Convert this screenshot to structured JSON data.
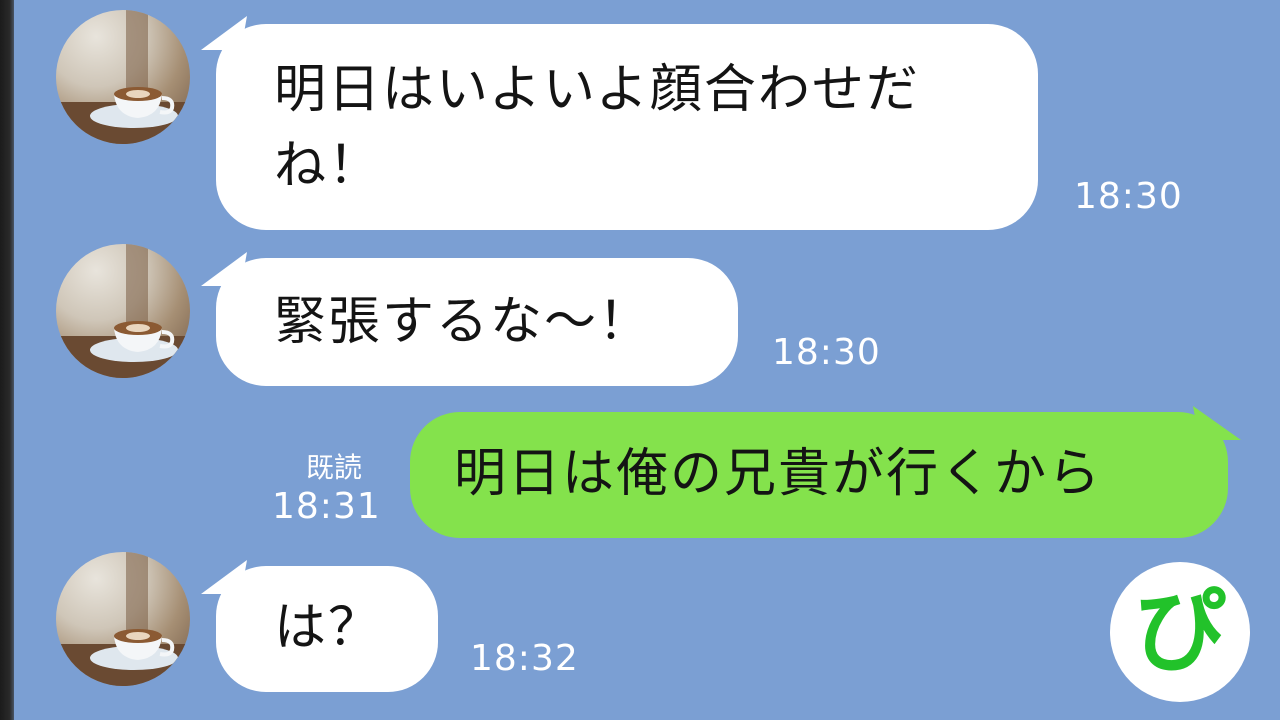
{
  "chat": {
    "messages": [
      {
        "sender": "other",
        "lines": [
          "明日はいよいよ顔合わせだ",
          "ね！"
        ],
        "time": "18:30"
      },
      {
        "sender": "other",
        "lines": [
          "緊張するな〜！"
        ],
        "time": "18:30"
      },
      {
        "sender": "self",
        "lines": [
          "明日は俺の兄貴が行くから"
        ],
        "time": "18:31",
        "read": "既読"
      },
      {
        "sender": "other",
        "lines": [
          "は？"
        ],
        "time": "18:32"
      }
    ]
  },
  "badge": {
    "glyph": "ぴ"
  },
  "colors": {
    "background": "#7b9fd3",
    "incoming_bubble": "#ffffff",
    "outgoing_bubble": "#84e24c",
    "badge_text": "#22c22a"
  },
  "icons": {
    "avatar": "coffee-cup-photo-avatar"
  }
}
